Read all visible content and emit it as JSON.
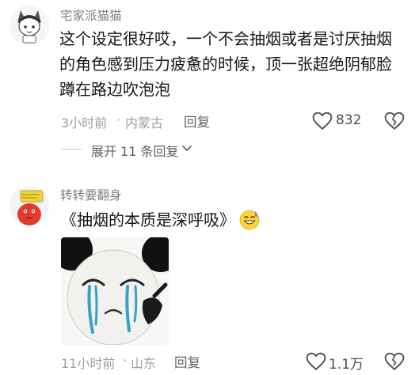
{
  "comments": [
    {
      "username": "宅家派猫猫",
      "text_lines": [
        "这个设定很好哎，一个不会抽烟或者是讨厌抽烟",
        "的角色感到压力疲惫的时候，顶一张超绝阴郁脸",
        "蹲在路边吹泡泡"
      ],
      "time": "3小时前",
      "location": "内蒙古",
      "reply_label": "回复",
      "likes": "832",
      "avatar_icon": "anime-cat-girl-avatar",
      "expand_label": "展开 11 条回复"
    },
    {
      "username": "转转要翻身",
      "text": "《抽烟的本质是深呼吸》",
      "emoji": "grinning-sweat-emoji",
      "time": "11小时前",
      "location": "山东",
      "reply_label": "回复",
      "likes": "1.1万",
      "avatar_icon": "red-cartoon-avatar",
      "image": "crying-panda-meme"
    }
  ],
  "colors": {
    "username": "#7b7f86",
    "body_text": "#161616",
    "meta": "#9a9ea5",
    "icon_stroke": "#4a4d52"
  }
}
